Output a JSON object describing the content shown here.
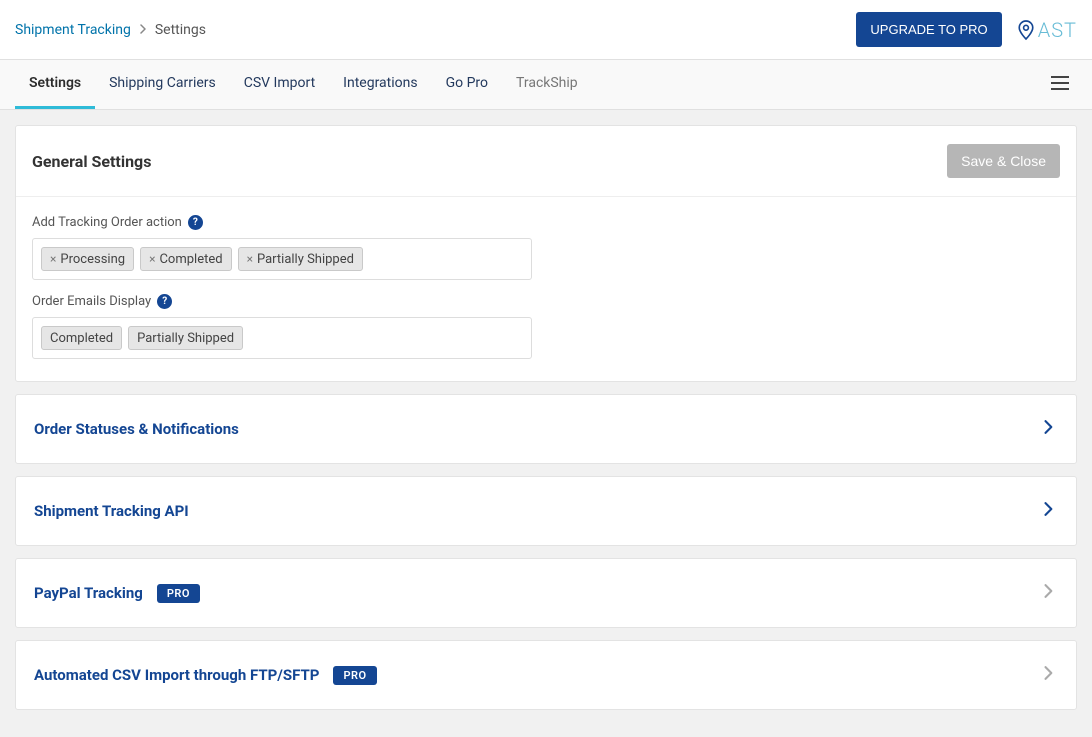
{
  "breadcrumb": {
    "root": "Shipment Tracking",
    "current": "Settings"
  },
  "header": {
    "upgrade_label": "UPGRADE TO PRO",
    "logo_text": "AST"
  },
  "tabs": [
    {
      "label": "Settings",
      "active": true
    },
    {
      "label": "Shipping Carriers",
      "active": false
    },
    {
      "label": "CSV Import",
      "active": false
    },
    {
      "label": "Integrations",
      "active": false
    },
    {
      "label": "Go Pro",
      "active": false
    },
    {
      "label": "TrackShip",
      "active": false,
      "muted": true
    }
  ],
  "general": {
    "title": "General Settings",
    "save_label": "Save & Close",
    "field1_label": "Add Tracking Order action",
    "field1_tags": [
      "Processing",
      "Completed",
      "Partially Shipped"
    ],
    "field2_label": "Order Emails Display",
    "field2_tags": [
      "Completed",
      "Partially Shipped"
    ]
  },
  "sections": [
    {
      "title": "Order Statuses & Notifications",
      "pro": false,
      "muted": false
    },
    {
      "title": "Shipment Tracking API",
      "pro": false,
      "muted": false
    },
    {
      "title": "PayPal Tracking",
      "pro": true,
      "muted": true
    },
    {
      "title": "Automated CSV Import through FTP/SFTP",
      "pro": true,
      "muted": true
    }
  ],
  "pro_badge_label": "PRO"
}
